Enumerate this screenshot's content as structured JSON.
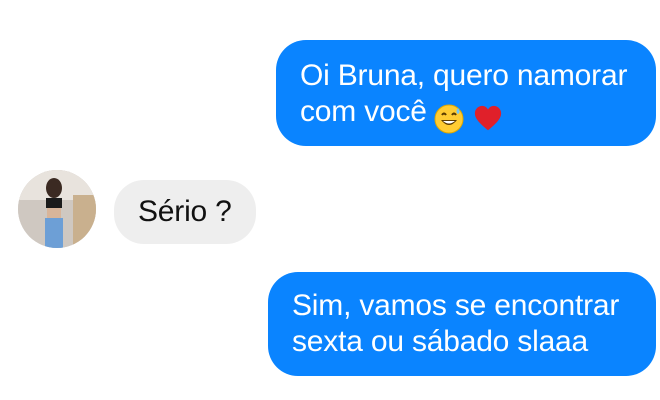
{
  "messages": [
    {
      "sender": "me",
      "lines": [
        "Oi Bruna, quero namorar",
        "com você"
      ],
      "emojis": [
        "grinning-sweat-icon",
        "red-heart-icon"
      ]
    },
    {
      "sender": "Bruna",
      "lines": [
        "Sério ?"
      ]
    },
    {
      "sender": "me",
      "lines": [
        "Sim, vamos se encontrar",
        "sexta ou sábado slaaa"
      ]
    }
  ],
  "colors": {
    "outgoing_bubble": "#0a84ff",
    "incoming_bubble": "#eeeeee",
    "background": "#ffffff"
  }
}
